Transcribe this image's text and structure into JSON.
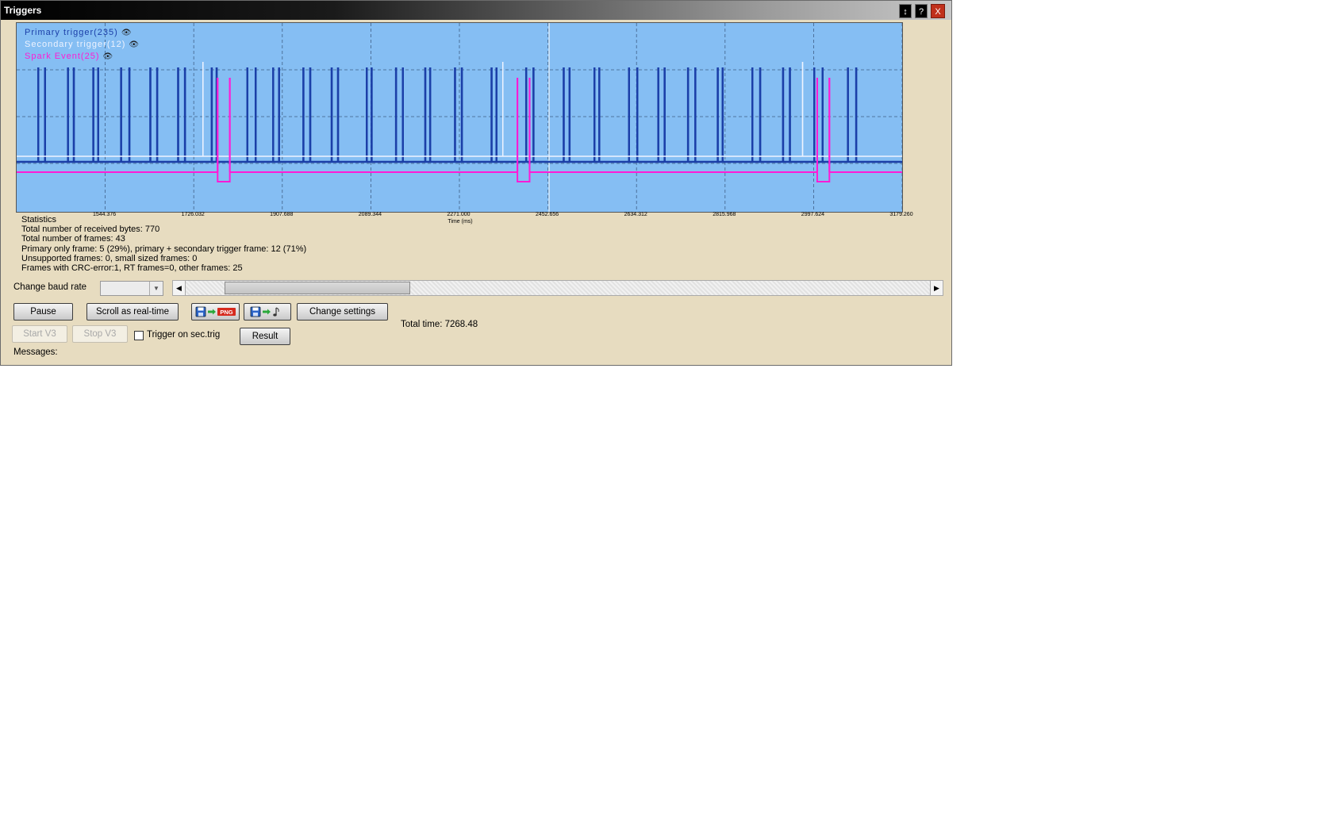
{
  "window": {
    "title": "Triggers",
    "buttons": {
      "resize": "↕",
      "help": "?",
      "close": "X"
    }
  },
  "chart_data": {
    "type": "line",
    "title": "",
    "xlabel": "Time (ms)",
    "ylabel": "",
    "xlim": [
      1362.75,
      3179.26
    ],
    "x_ticks": [
      "1544.376",
      "1726.032",
      "1907.688",
      "2089.344",
      "2271.000",
      "2452.656",
      "2634.312",
      "2815.968",
      "2997.624",
      "3179.260"
    ],
    "grid": true,
    "legend_position": "top-left",
    "cursor_x": 2455,
    "series": [
      {
        "name": "Primary trigger(235)",
        "color": "#1b3fa8",
        "pulses": [
          1407,
          1421,
          1468,
          1480,
          1520,
          1530,
          1577,
          1594,
          1637,
          1651,
          1694,
          1708,
          1763,
          1773,
          1836,
          1853,
          1889,
          1901,
          1951,
          1965,
          2009,
          2022,
          2081,
          2091,
          2141,
          2155,
          2201,
          2211,
          2262,
          2276,
          2337,
          2347,
          2408,
          2423,
          2485,
          2497,
          2548,
          2558,
          2619,
          2636,
          2679,
          2692,
          2740,
          2755,
          2801,
          2811,
          2872,
          2888,
          2935,
          2949,
          2999,
          3016,
          3068,
          3085
        ]
      },
      {
        "name": "Secondary trigger(12)",
        "color": "#eef3ff",
        "pulses": [
          1745,
          2360,
          2975
        ]
      },
      {
        "name": "Spark Event(25)",
        "color": "#ff1bd5",
        "pulses": [
          1775,
          1800,
          2390,
          2415,
          3005,
          3030
        ]
      }
    ]
  },
  "statistics": {
    "heading": "Statistics",
    "lines": [
      "Total number of received bytes: 770",
      "Total number of frames: 43",
      "Primary only frame: 5 (29%), primary + secondary trigger frame: 12 (71%)",
      "Unsupported frames: 0, small sized frames: 0",
      "Frames with CRC-error:1, RT frames=0, other frames: 25"
    ]
  },
  "controls": {
    "baud_label": "Change baud rate",
    "baud_value": "",
    "scroll_position": 0.07,
    "pause": "Pause",
    "scroll_realtime": "Scroll as real-time",
    "png_text": "PNG",
    "change_settings": "Change settings",
    "start_v3": "Start V3",
    "stop_v3": "Stop V3",
    "trigger_on_sec": "Trigger on sec.trig",
    "result": "Result",
    "total_time": "Total time: 7268.48",
    "messages": "Messages:"
  }
}
